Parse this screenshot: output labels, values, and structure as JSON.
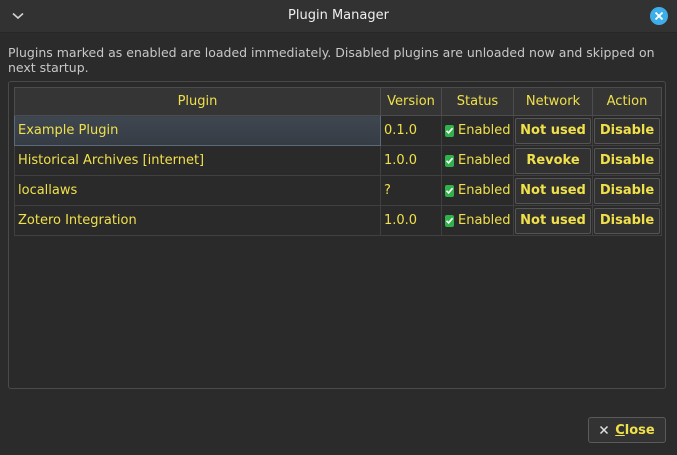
{
  "window": {
    "title": "Plugin Manager",
    "menu_icon": "chevron-down-icon",
    "close_icon": "close-icon",
    "accent": "#3daee9"
  },
  "description": "Plugins marked as enabled are loaded immediately. Disabled plugins are unloaded now and skipped on next startup.",
  "table": {
    "headers": {
      "plugin": "Plugin",
      "version": "Version",
      "status": "Status",
      "network": "Network",
      "action": "Action"
    },
    "rows": [
      {
        "plugin": "Example Plugin",
        "version": "0.1.0",
        "status": "Enabled",
        "network": "Not used",
        "action": "Disable",
        "selected": true
      },
      {
        "plugin": "Historical Archives [internet]",
        "version": "1.0.0",
        "status": "Enabled",
        "network": "Revoke",
        "action": "Disable"
      },
      {
        "plugin": "locallaws",
        "version": "?",
        "status": "Enabled",
        "network": "Not used",
        "action": "Disable"
      },
      {
        "plugin": "Zotero Integration",
        "version": "1.0.0",
        "status": "Enabled",
        "network": "Not used",
        "action": "Disable"
      }
    ],
    "text_color": "#f0e04a",
    "status_icon": "checkmark-icon",
    "status_color": "#2fb34a"
  },
  "footer": {
    "close_label_mnemonic": "C",
    "close_label_rest": "lose",
    "close_icon": "x-icon"
  }
}
